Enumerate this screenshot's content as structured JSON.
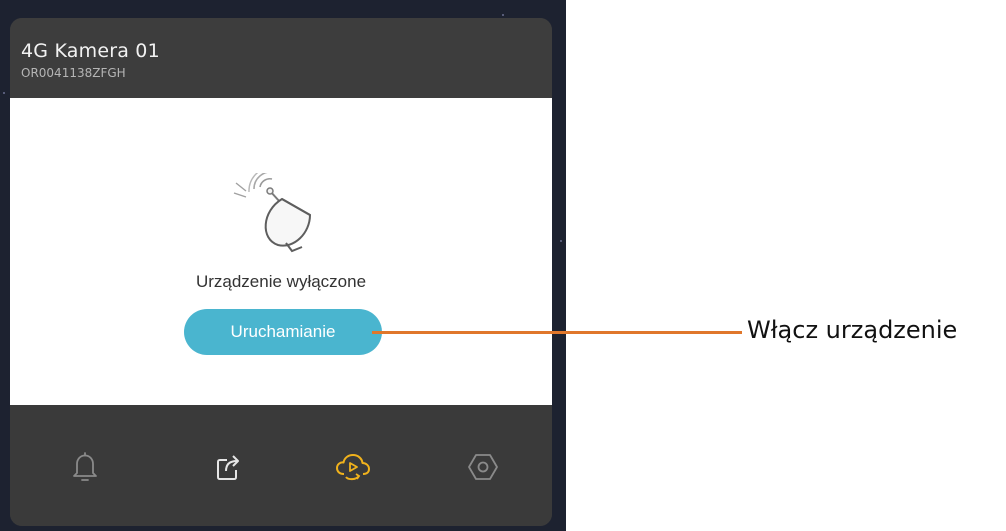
{
  "device": {
    "name": "4G Kamera 01",
    "serial": "OR0041138ZFGH"
  },
  "content": {
    "status_text": "Urządzenie wyłączone",
    "power_button_label": "Uruchamianie",
    "illustration_icon": "satellite-dish-icon"
  },
  "toolbar": {
    "items": [
      {
        "icon": "bell-icon",
        "color": "#8a8a8a"
      },
      {
        "icon": "share-icon",
        "color": "#e6e6e6"
      },
      {
        "icon": "cloud-playback-icon",
        "color": "#f1b21c"
      },
      {
        "icon": "settings-icon",
        "color": "#8a8a8a"
      }
    ]
  },
  "annotation": {
    "label": "Włącz urządzenie",
    "line_color": "#e0772b"
  },
  "colors": {
    "accent": "#4ab5cf",
    "header_bg": "#3d3d3d",
    "toolbar_bg": "#3a3a3a"
  }
}
